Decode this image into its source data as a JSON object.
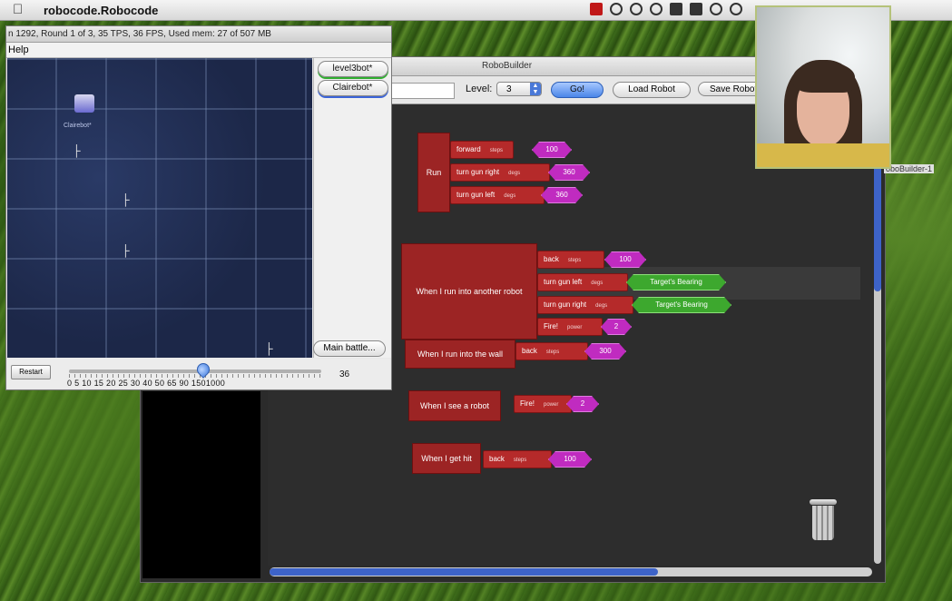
{
  "menubar": {
    "apple": "",
    "app_name": "robocode.Robocode"
  },
  "robocode": {
    "status": "n 1292, Round 1 of 3, 35 TPS, 36 FPS, Used mem: 27 of 507 MB",
    "menu_help": "Help",
    "robot_label": "Clairebot*",
    "robots": [
      "level3bot*",
      "Clairebot*"
    ],
    "main_battle": "Main battle...",
    "restart": "Restart",
    "slider_numbers": "0  5  10 15 20 25 30 40 50 65 90 1501000",
    "tps_value": "36",
    "tps_slider_fraction": 0.53
  },
  "robobuilder": {
    "title": "RoboBuilder",
    "level_label": "Level:",
    "level_value": "3",
    "go": "Go!",
    "load_robot": "Load Robot",
    "save_robot": "Save Robot",
    "tab_label": "oboBuilder-1",
    "blocks": {
      "run": {
        "label": "Run",
        "cmds": [
          {
            "text": "forward",
            "unit": "steps",
            "value": "100"
          },
          {
            "text": "turn gun right",
            "unit": "degs",
            "value": "360"
          },
          {
            "text": "turn gun left",
            "unit": "degs",
            "value": "360"
          }
        ]
      },
      "hit_robot": {
        "label": "When I run into another robot",
        "cmds": [
          {
            "text": "back",
            "unit": "steps",
            "value": "100"
          },
          {
            "text": "turn gun left",
            "unit": "degs",
            "value": "Target's Bearing"
          },
          {
            "text": "turn gun right",
            "unit": "degs",
            "value": "Target's Bearing"
          },
          {
            "text": "Fire!",
            "unit": "power",
            "value": "2"
          }
        ]
      },
      "hit_wall": {
        "label": "When I run into the wall",
        "cmd": {
          "text": "back",
          "unit": "steps",
          "value": "300"
        }
      },
      "see_robot": {
        "label": "When I see a robot",
        "cmd": {
          "text": "Fire!",
          "unit": "power",
          "value": "2"
        }
      },
      "get_hit": {
        "label": "When I get hit",
        "cmd": {
          "text": "back",
          "unit": "steps",
          "value": "100"
        }
      }
    }
  }
}
